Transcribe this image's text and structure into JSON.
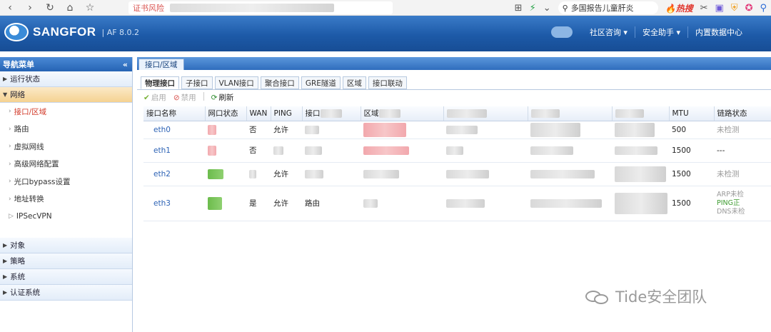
{
  "browser": {
    "cert_warning": "证书风险",
    "search_text": "多国报告儿童肝炎",
    "hot_label": "热搜"
  },
  "header": {
    "brand": "SANGFOR",
    "version": "AF 8.0.2",
    "menu": [
      "社区咨询",
      "安全助手",
      "内置数据中心"
    ]
  },
  "sidebar": {
    "title": "导航菜单",
    "collapse_glyph": "«",
    "groups_top": [
      {
        "label": "运行状态",
        "open": false
      },
      {
        "label": "网络",
        "open": true
      }
    ],
    "network_items": [
      "接口/区域",
      "路由",
      "虚拟网线",
      "高级网络配置",
      "光口bypass设置",
      "地址转换",
      "IPSecVPN"
    ],
    "active_item": "接口/区域",
    "groups_bottom": [
      "对象",
      "策略",
      "系统",
      "认证系统"
    ]
  },
  "main": {
    "tab_label": "接口/区域",
    "subtabs": [
      "物理接口",
      "子接口",
      "VLAN接口",
      "聚合接口",
      "GRE隧道",
      "区域",
      "接口联动"
    ],
    "active_subtab": "物理接口",
    "toolbar": {
      "enable": "启用",
      "disable": "禁用",
      "refresh": "刷新"
    },
    "columns": [
      "接口名称",
      "网口状态",
      "WAN",
      "PING",
      "接口",
      "区域",
      "",
      "",
      "",
      "MTU",
      "链路状态"
    ],
    "rows": [
      {
        "name": "eth0",
        "wan": "否",
        "ping": "允许",
        "iface": "",
        "mtu": "500",
        "link": "未检测"
      },
      {
        "name": "eth1",
        "wan": "否",
        "ping": "",
        "iface": "",
        "mtu": "1500",
        "link": "---"
      },
      {
        "name": "eth2",
        "wan": "",
        "ping": "允许",
        "iface": "",
        "mtu": "1500",
        "link": "未检测"
      },
      {
        "name": "eth3",
        "wan": "是",
        "ping": "允许",
        "iface": "路由",
        "mtu": "1500",
        "link_lines": [
          "ARP未检",
          "PING正",
          "DNS未检"
        ]
      }
    ]
  },
  "watermark": {
    "text": "Tide安全团队"
  },
  "colors": {
    "brand_blue": "#1d5aa8",
    "link": "#2c62b5",
    "active_nav": "#d23b2a",
    "ok_green": "#3d9b2f"
  }
}
